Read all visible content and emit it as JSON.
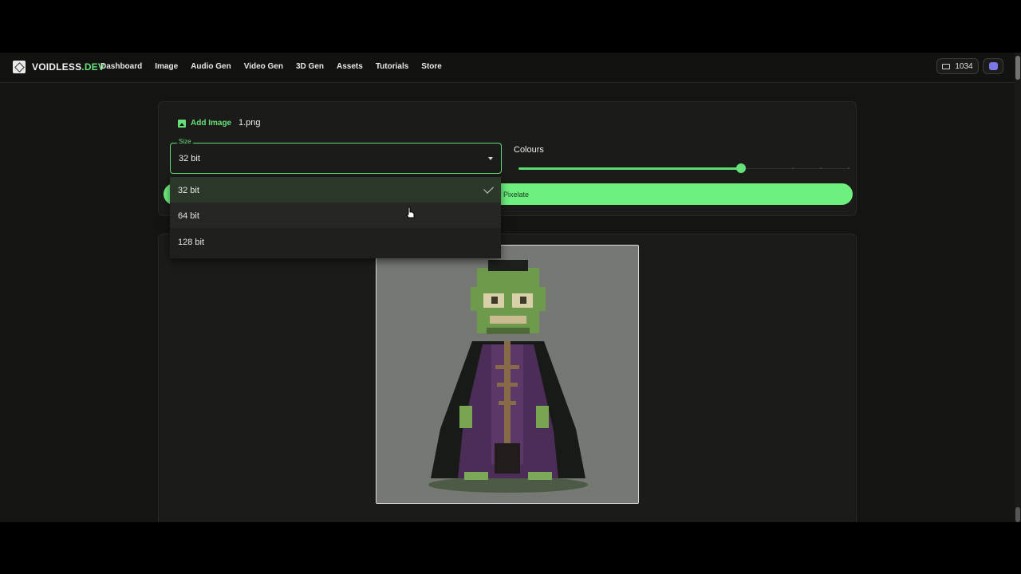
{
  "header": {
    "logo_text": "VOIDLESS",
    "logo_accent": ".DEV",
    "nav": [
      "Dashboard",
      "Image",
      "Audio Gen",
      "Video Gen",
      "3D Gen",
      "Assets",
      "Tutorials",
      "Store"
    ],
    "credits": "1034"
  },
  "controls": {
    "add_image_label": "Add Image",
    "filename": "1.png",
    "size_label": "Size",
    "size_value": "32 bit",
    "colours_label": "Colours",
    "colours_level": 0.67,
    "pixelate_label": "Pixelate"
  },
  "dropdown": {
    "options": [
      "32 bit",
      "64 bit",
      "128 bit"
    ],
    "selected": "32 bit"
  },
  "preview": {
    "image_description": "pixel-art zombie wizard"
  },
  "colors": {
    "accent": "#66e07a",
    "background": "#141412",
    "panel": "#1b1b19"
  }
}
